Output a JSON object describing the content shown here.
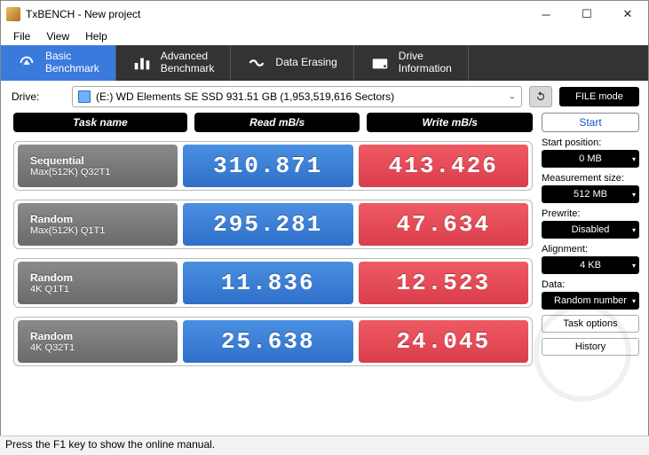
{
  "window": {
    "title": "TxBENCH - New project"
  },
  "menu": {
    "file": "File",
    "view": "View",
    "help": "Help"
  },
  "tabs": {
    "basic": "Basic\nBenchmark",
    "advanced": "Advanced\nBenchmark",
    "erasing": "Data Erasing",
    "drive": "Drive\nInformation"
  },
  "driveRow": {
    "label": "Drive:",
    "selected": "(E:) WD Elements SE SSD  931.51 GB (1,953,519,616 Sectors)",
    "modeBtn": "FILE mode"
  },
  "headers": {
    "task": "Task name",
    "read": "Read mB/s",
    "write": "Write mB/s"
  },
  "rows": [
    {
      "name1": "Sequential",
      "name2": "Max(512K) Q32T1",
      "read": "310.871",
      "write": "413.426"
    },
    {
      "name1": "Random",
      "name2": "Max(512K) Q1T1",
      "read": "295.281",
      "write": "47.634"
    },
    {
      "name1": "Random",
      "name2": "4K Q1T1",
      "read": "11.836",
      "write": "12.523"
    },
    {
      "name1": "Random",
      "name2": "4K Q32T1",
      "read": "25.638",
      "write": "24.045"
    }
  ],
  "side": {
    "start": "Start",
    "startPos": {
      "label": "Start position:",
      "value": "0 MB"
    },
    "measSize": {
      "label": "Measurement size:",
      "value": "512 MB"
    },
    "prewrite": {
      "label": "Prewrite:",
      "value": "Disabled"
    },
    "alignment": {
      "label": "Alignment:",
      "value": "4 KB"
    },
    "data": {
      "label": "Data:",
      "value": "Random number"
    },
    "taskOptions": "Task options",
    "history": "History"
  },
  "status": "Press the F1 key to show the online manual."
}
